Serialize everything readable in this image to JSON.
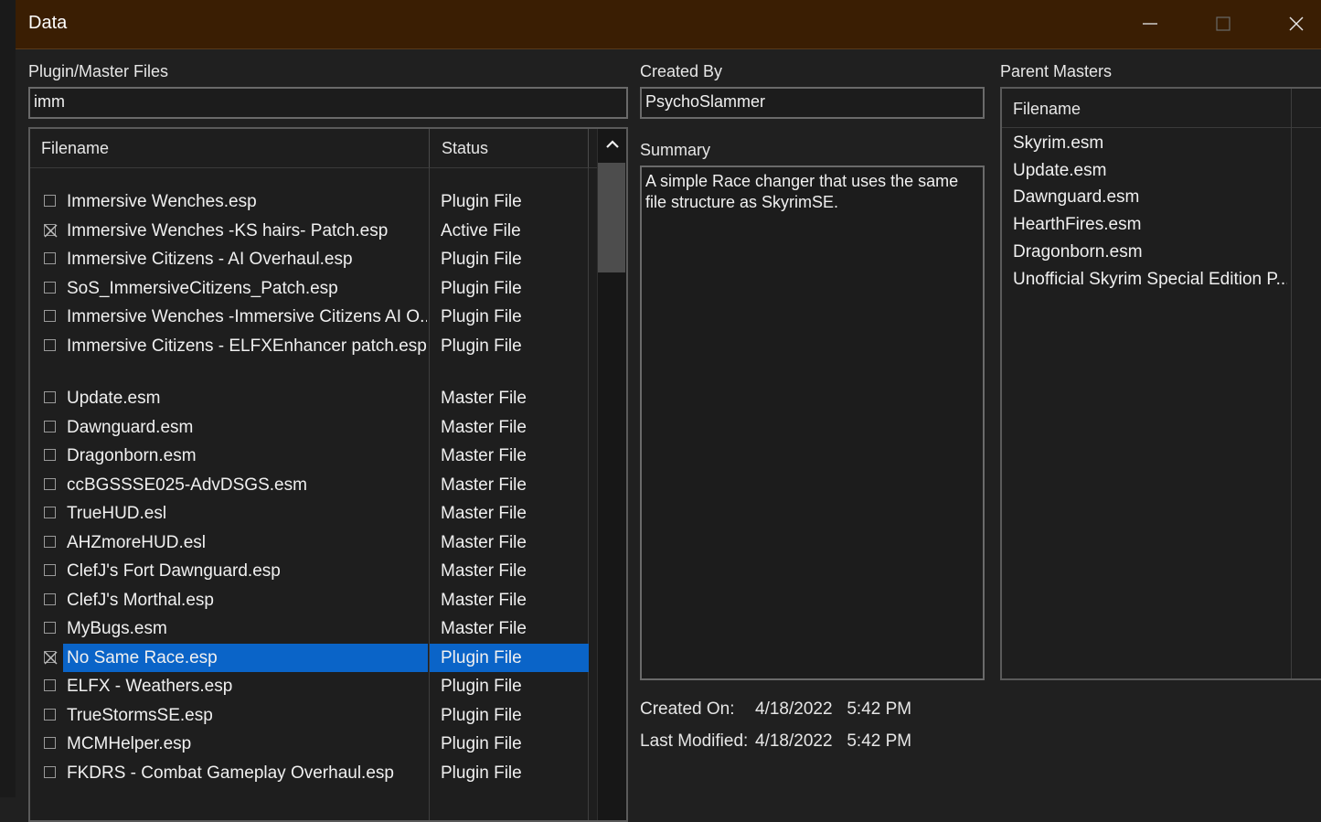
{
  "window": {
    "title": "Data",
    "minimize_icon": "minimize-icon",
    "maximize_icon": "maximize-icon",
    "close_icon": "close-icon",
    "titlebar_color": "#3a1e03"
  },
  "plugins": {
    "label": "Plugin/Master Files",
    "search_value": "imm",
    "columns": {
      "filename": "Filename",
      "status": "Status"
    },
    "selected_color": "#0a64c8",
    "rows": [
      {
        "name": "Immersive Wenches.esp",
        "status": "Plugin File",
        "checked": false,
        "selected": false
      },
      {
        "name": "Immersive Wenches -KS hairs- Patch.esp",
        "status": "Active File",
        "checked": true,
        "selected": false
      },
      {
        "name": "Immersive Citizens - AI Overhaul.esp",
        "status": "Plugin File",
        "checked": false,
        "selected": false
      },
      {
        "name": "SoS_ImmersiveCitizens_Patch.esp",
        "status": "Plugin File",
        "checked": false,
        "selected": false
      },
      {
        "name": "Immersive Wenches -Immersive Citizens AI O...",
        "status": "Plugin File",
        "checked": false,
        "selected": false
      },
      {
        "name": "Immersive Citizens - ELFXEnhancer patch.esp",
        "status": "Plugin File",
        "checked": false,
        "selected": false
      },
      {
        "name": "Update.esm",
        "status": "Master File",
        "checked": false,
        "selected": false
      },
      {
        "name": "Dawnguard.esm",
        "status": "Master File",
        "checked": false,
        "selected": false
      },
      {
        "name": "Dragonborn.esm",
        "status": "Master File",
        "checked": false,
        "selected": false
      },
      {
        "name": "ccBGSSSE025-AdvDSGS.esm",
        "status": "Master File",
        "checked": false,
        "selected": false
      },
      {
        "name": "TrueHUD.esl",
        "status": "Master File",
        "checked": false,
        "selected": false
      },
      {
        "name": "AHZmoreHUD.esl",
        "status": "Master File",
        "checked": false,
        "selected": false
      },
      {
        "name": "ClefJ's Fort Dawnguard.esp",
        "status": "Master File",
        "checked": false,
        "selected": false
      },
      {
        "name": "ClefJ's Morthal.esp",
        "status": "Master File",
        "checked": false,
        "selected": false
      },
      {
        "name": "MyBugs.esm",
        "status": "Master File",
        "checked": false,
        "selected": false
      },
      {
        "name": "No Same Race.esp",
        "status": "Plugin File",
        "checked": true,
        "selected": true
      },
      {
        "name": "ELFX - Weathers.esp",
        "status": "Plugin File",
        "checked": false,
        "selected": false
      },
      {
        "name": "TrueStormsSE.esp",
        "status": "Plugin File",
        "checked": false,
        "selected": false
      },
      {
        "name": "MCMHelper.esp",
        "status": "Plugin File",
        "checked": false,
        "selected": false
      },
      {
        "name": "FKDRS - Combat Gameplay Overhaul.esp",
        "status": "Plugin File",
        "checked": false,
        "selected": false
      }
    ]
  },
  "details": {
    "created_by_label": "Created By",
    "created_by_value": "PsychoSlammer",
    "summary_label": "Summary",
    "summary_text": "A simple Race changer that uses the same file structure as SkyrimSE.",
    "created_on_label": "Created On:",
    "created_on_value": "4/18/2022   5:42 PM",
    "last_modified_label": "Last Modified:",
    "last_modified_value": "4/18/2022   5:42 PM"
  },
  "masters": {
    "label": "Parent Masters",
    "column": "Filename",
    "rows": [
      "Skyrim.esm",
      "Update.esm",
      "Dawnguard.esm",
      "HearthFires.esm",
      "Dragonborn.esm",
      "Unofficial Skyrim Special Edition P..."
    ]
  }
}
